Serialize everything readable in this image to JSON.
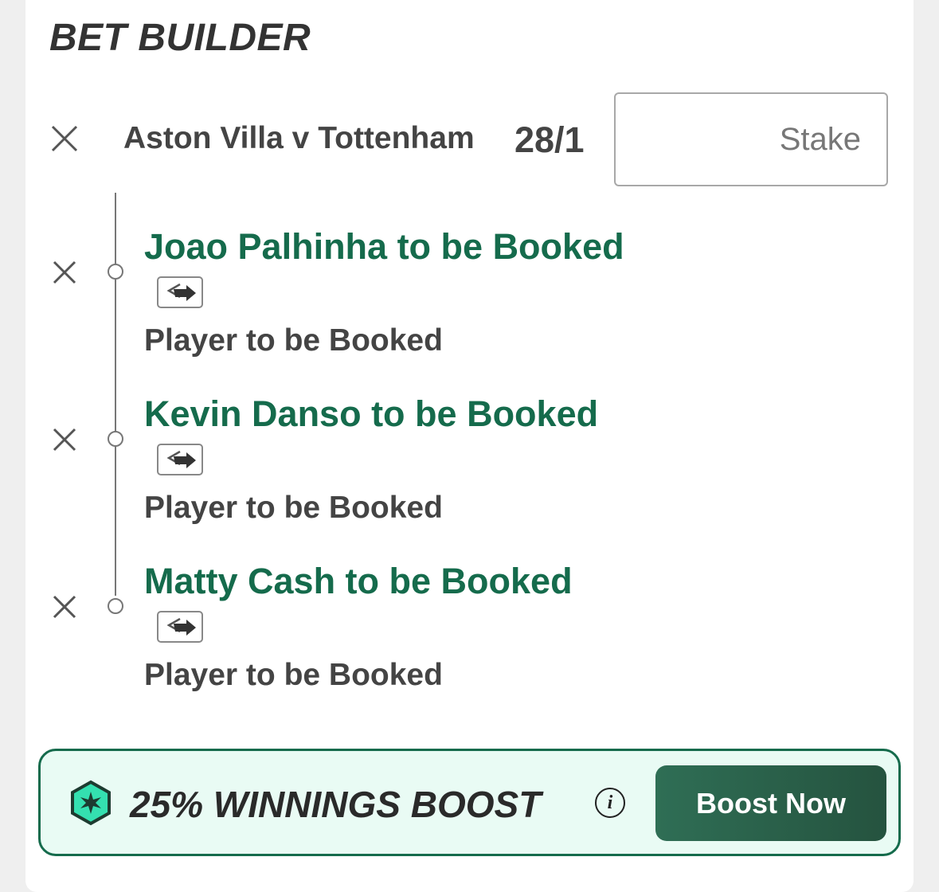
{
  "header": {
    "title": "BET BUILDER"
  },
  "event": {
    "name": "Aston Villa v Tottenham",
    "odds": "28/1",
    "stake_placeholder": "Stake"
  },
  "selections": [
    {
      "name": "Joao Palhinha to be Booked",
      "market": "Player to be Booked"
    },
    {
      "name": "Kevin Danso to be Booked",
      "market": "Player to be Booked"
    },
    {
      "name": "Matty Cash to be Booked",
      "market": "Player to be Booked"
    }
  ],
  "boost": {
    "text": "25% WINNINGS BOOST",
    "button_label": "Boost Now",
    "info_glyph": "i"
  },
  "colors": {
    "accent_green": "#156b4c",
    "boost_bg": "#e9fbf4",
    "button_bg": "#2a5f4a",
    "boost_icon_fill": "#34e0b0"
  },
  "icons": [
    "close-icon",
    "swap-icon",
    "info-icon",
    "boost-star-icon"
  ]
}
